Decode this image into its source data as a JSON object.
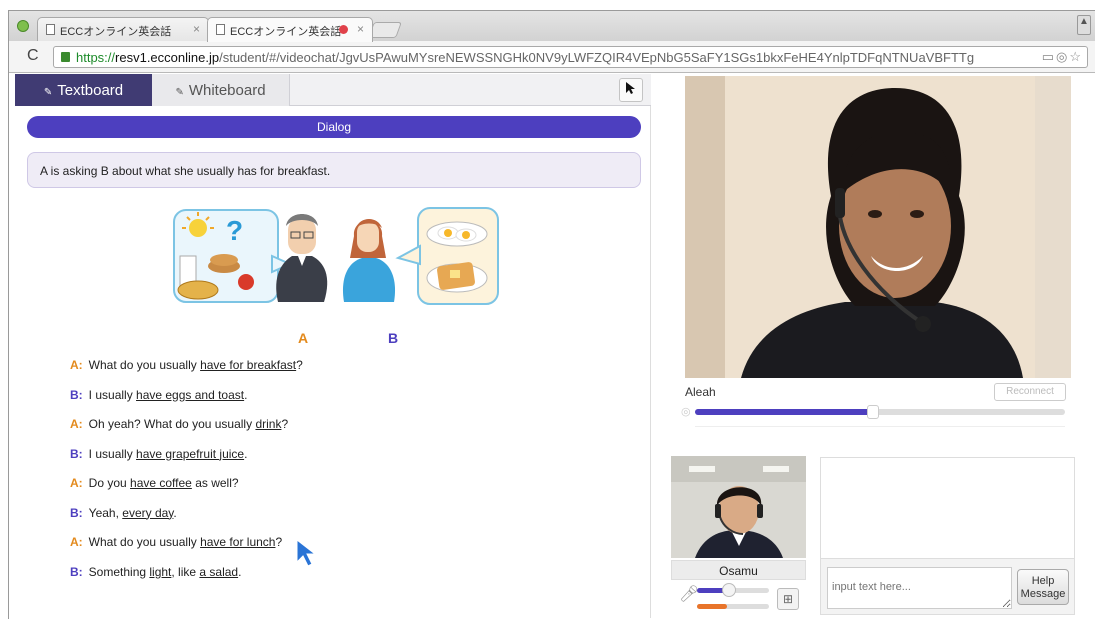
{
  "browser": {
    "tabs": [
      {
        "title": "ECCオンライン英会話"
      },
      {
        "title": "ECCオンライン英会話"
      }
    ],
    "url": {
      "scheme": "https://",
      "host": "resv1.ecconline.jp",
      "path": "/student/#/videochat/JgvUsPAwuMYsreNEWSSNGHk0NV9yLWFZQIR4VEpNbG5SaFY1SGs1bkxFeHE4YnlpTDFqNTNUaVBFTTg"
    }
  },
  "board_tabs": {
    "textboard": "Textboard",
    "whiteboard": "Whiteboard"
  },
  "lesson": {
    "section_title": "Dialog",
    "context": "A is asking B about what she usually has for breakfast.",
    "illustration_labels": {
      "a": "A",
      "b": "B"
    },
    "lines": [
      {
        "speaker": "A:",
        "parts": [
          {
            "t": "What do you usually "
          },
          {
            "t": "have for breakfast",
            "u": true
          },
          {
            "t": "?"
          }
        ]
      },
      {
        "speaker": "B:",
        "parts": [
          {
            "t": "I usually "
          },
          {
            "t": "have eggs and toast",
            "u": true
          },
          {
            "t": "."
          }
        ]
      },
      {
        "speaker": "A:",
        "parts": [
          {
            "t": "Oh yeah? What do you usually "
          },
          {
            "t": "drink",
            "u": true
          },
          {
            "t": "?"
          }
        ]
      },
      {
        "speaker": "B:",
        "parts": [
          {
            "t": "I usually "
          },
          {
            "t": "have grapefruit juice",
            "u": true
          },
          {
            "t": "."
          }
        ]
      },
      {
        "speaker": "A:",
        "parts": [
          {
            "t": "Do you "
          },
          {
            "t": "have coffee",
            "u": true
          },
          {
            "t": " as well?"
          }
        ]
      },
      {
        "speaker": "B:",
        "parts": [
          {
            "t": "Yeah, "
          },
          {
            "t": "every day",
            "u": true
          },
          {
            "t": "."
          }
        ]
      },
      {
        "speaker": "A:",
        "parts": [
          {
            "t": "What do you usually "
          },
          {
            "t": "have for lunch",
            "u": true
          },
          {
            "t": "?"
          }
        ]
      },
      {
        "speaker": "B:",
        "parts": [
          {
            "t": "Something "
          },
          {
            "t": "light",
            "u": true
          },
          {
            "t": ", like "
          },
          {
            "t": "a salad",
            "u": true
          },
          {
            "t": "."
          }
        ]
      }
    ]
  },
  "video": {
    "tutor_name": "Aleah",
    "reconnect_label": "Reconnect",
    "volume_level": 0.48,
    "student_name": "Osamu",
    "mic_level": 0.45,
    "input_level": 0.42
  },
  "chat": {
    "input_placeholder": "input text here...",
    "help_button": "Help Message"
  },
  "colors": {
    "accent_purple": "#4d3fbf",
    "speaker_a": "#e38a1d",
    "speaker_b": "#4d3fbf",
    "level_orange": "#e8742a"
  }
}
